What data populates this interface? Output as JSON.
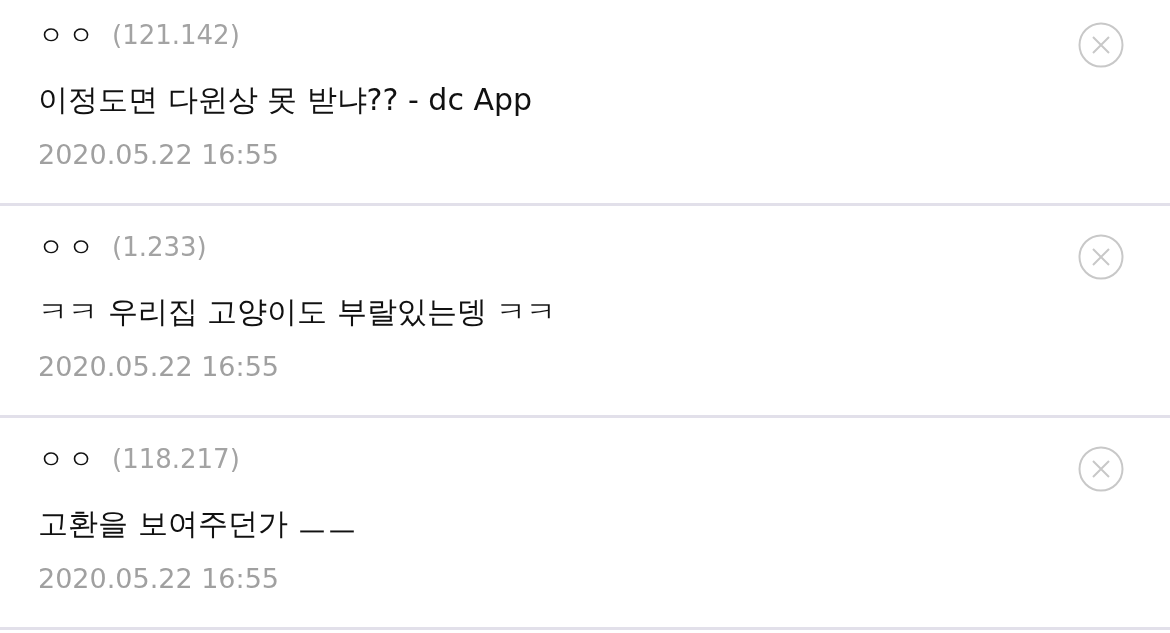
{
  "comments": [
    {
      "author": "ㅇㅇ",
      "ip": "(121.142)",
      "text": "이정도면 다윈상 못 받냐?? - dc App",
      "date": "2020.05.22 16:55"
    },
    {
      "author": "ㅇㅇ",
      "ip": "(1.233)",
      "text": "ㅋㅋ 우리집 고양이도 부랄있는뎅 ㅋㅋ",
      "date": "2020.05.22 16:55"
    },
    {
      "author": "ㅇㅇ",
      "ip": "(118.217)",
      "text": "고환을 보여주던가 ㅡㅡ",
      "date": "2020.05.22 16:55"
    }
  ]
}
